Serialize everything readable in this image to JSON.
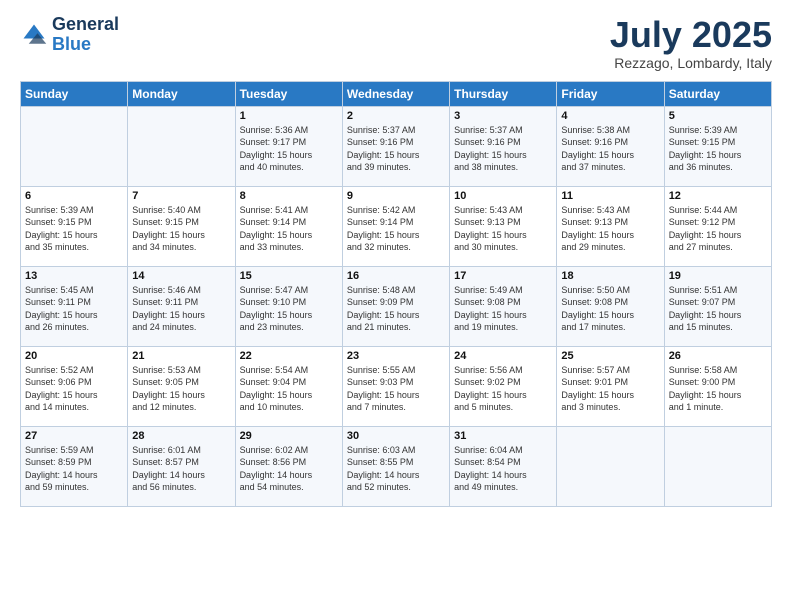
{
  "header": {
    "logo_general": "General",
    "logo_blue": "Blue",
    "month_title": "July 2025",
    "location": "Rezzago, Lombardy, Italy"
  },
  "days_of_week": [
    "Sunday",
    "Monday",
    "Tuesday",
    "Wednesday",
    "Thursday",
    "Friday",
    "Saturday"
  ],
  "weeks": [
    [
      {
        "day": "",
        "info": ""
      },
      {
        "day": "",
        "info": ""
      },
      {
        "day": "1",
        "info": "Sunrise: 5:36 AM\nSunset: 9:17 PM\nDaylight: 15 hours\nand 40 minutes."
      },
      {
        "day": "2",
        "info": "Sunrise: 5:37 AM\nSunset: 9:16 PM\nDaylight: 15 hours\nand 39 minutes."
      },
      {
        "day": "3",
        "info": "Sunrise: 5:37 AM\nSunset: 9:16 PM\nDaylight: 15 hours\nand 38 minutes."
      },
      {
        "day": "4",
        "info": "Sunrise: 5:38 AM\nSunset: 9:16 PM\nDaylight: 15 hours\nand 37 minutes."
      },
      {
        "day": "5",
        "info": "Sunrise: 5:39 AM\nSunset: 9:15 PM\nDaylight: 15 hours\nand 36 minutes."
      }
    ],
    [
      {
        "day": "6",
        "info": "Sunrise: 5:39 AM\nSunset: 9:15 PM\nDaylight: 15 hours\nand 35 minutes."
      },
      {
        "day": "7",
        "info": "Sunrise: 5:40 AM\nSunset: 9:15 PM\nDaylight: 15 hours\nand 34 minutes."
      },
      {
        "day": "8",
        "info": "Sunrise: 5:41 AM\nSunset: 9:14 PM\nDaylight: 15 hours\nand 33 minutes."
      },
      {
        "day": "9",
        "info": "Sunrise: 5:42 AM\nSunset: 9:14 PM\nDaylight: 15 hours\nand 32 minutes."
      },
      {
        "day": "10",
        "info": "Sunrise: 5:43 AM\nSunset: 9:13 PM\nDaylight: 15 hours\nand 30 minutes."
      },
      {
        "day": "11",
        "info": "Sunrise: 5:43 AM\nSunset: 9:13 PM\nDaylight: 15 hours\nand 29 minutes."
      },
      {
        "day": "12",
        "info": "Sunrise: 5:44 AM\nSunset: 9:12 PM\nDaylight: 15 hours\nand 27 minutes."
      }
    ],
    [
      {
        "day": "13",
        "info": "Sunrise: 5:45 AM\nSunset: 9:11 PM\nDaylight: 15 hours\nand 26 minutes."
      },
      {
        "day": "14",
        "info": "Sunrise: 5:46 AM\nSunset: 9:11 PM\nDaylight: 15 hours\nand 24 minutes."
      },
      {
        "day": "15",
        "info": "Sunrise: 5:47 AM\nSunset: 9:10 PM\nDaylight: 15 hours\nand 23 minutes."
      },
      {
        "day": "16",
        "info": "Sunrise: 5:48 AM\nSunset: 9:09 PM\nDaylight: 15 hours\nand 21 minutes."
      },
      {
        "day": "17",
        "info": "Sunrise: 5:49 AM\nSunset: 9:08 PM\nDaylight: 15 hours\nand 19 minutes."
      },
      {
        "day": "18",
        "info": "Sunrise: 5:50 AM\nSunset: 9:08 PM\nDaylight: 15 hours\nand 17 minutes."
      },
      {
        "day": "19",
        "info": "Sunrise: 5:51 AM\nSunset: 9:07 PM\nDaylight: 15 hours\nand 15 minutes."
      }
    ],
    [
      {
        "day": "20",
        "info": "Sunrise: 5:52 AM\nSunset: 9:06 PM\nDaylight: 15 hours\nand 14 minutes."
      },
      {
        "day": "21",
        "info": "Sunrise: 5:53 AM\nSunset: 9:05 PM\nDaylight: 15 hours\nand 12 minutes."
      },
      {
        "day": "22",
        "info": "Sunrise: 5:54 AM\nSunset: 9:04 PM\nDaylight: 15 hours\nand 10 minutes."
      },
      {
        "day": "23",
        "info": "Sunrise: 5:55 AM\nSunset: 9:03 PM\nDaylight: 15 hours\nand 7 minutes."
      },
      {
        "day": "24",
        "info": "Sunrise: 5:56 AM\nSunset: 9:02 PM\nDaylight: 15 hours\nand 5 minutes."
      },
      {
        "day": "25",
        "info": "Sunrise: 5:57 AM\nSunset: 9:01 PM\nDaylight: 15 hours\nand 3 minutes."
      },
      {
        "day": "26",
        "info": "Sunrise: 5:58 AM\nSunset: 9:00 PM\nDaylight: 15 hours\nand 1 minute."
      }
    ],
    [
      {
        "day": "27",
        "info": "Sunrise: 5:59 AM\nSunset: 8:59 PM\nDaylight: 14 hours\nand 59 minutes."
      },
      {
        "day": "28",
        "info": "Sunrise: 6:01 AM\nSunset: 8:57 PM\nDaylight: 14 hours\nand 56 minutes."
      },
      {
        "day": "29",
        "info": "Sunrise: 6:02 AM\nSunset: 8:56 PM\nDaylight: 14 hours\nand 54 minutes."
      },
      {
        "day": "30",
        "info": "Sunrise: 6:03 AM\nSunset: 8:55 PM\nDaylight: 14 hours\nand 52 minutes."
      },
      {
        "day": "31",
        "info": "Sunrise: 6:04 AM\nSunset: 8:54 PM\nDaylight: 14 hours\nand 49 minutes."
      },
      {
        "day": "",
        "info": ""
      },
      {
        "day": "",
        "info": ""
      }
    ]
  ]
}
